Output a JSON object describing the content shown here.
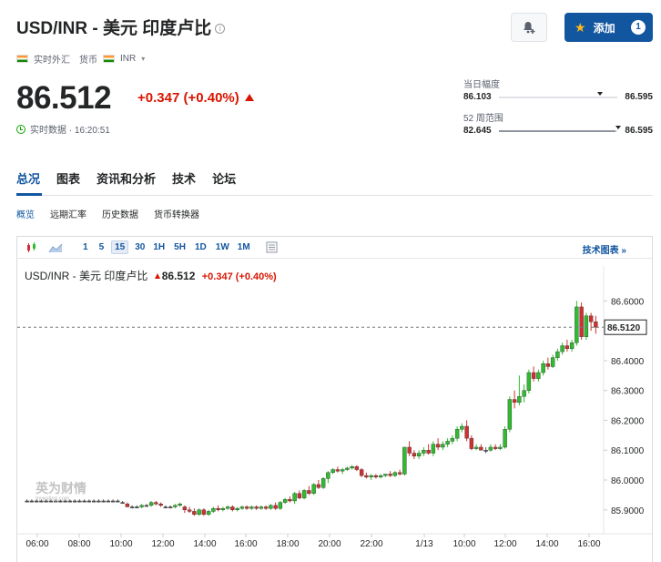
{
  "header": {
    "title": "USD/INR - 美元 印度卢比",
    "info": "i",
    "market_type": "实时外汇",
    "currency_label": "货币",
    "currency": "INR",
    "add_label": "添加",
    "add_count": "1"
  },
  "quote": {
    "price": "86.512",
    "change": "+0.347 (+0.40%)",
    "status": "实时数据 · 16:20:51"
  },
  "day_range": {
    "label": "当日幅度",
    "low": "86.103",
    "high": "86.595",
    "current_fraction": 0.83
  },
  "week52_range": {
    "label": "52 周范围",
    "low": "82.645",
    "high": "86.595",
    "current_fraction": 0.98
  },
  "tabs": [
    "总况",
    "图表",
    "资讯和分析",
    "技术",
    "论坛"
  ],
  "subtabs": [
    "概览",
    "远期汇率",
    "历史数据",
    "货币转换器"
  ],
  "chart_toolbar": {
    "timeframes": [
      "1",
      "5",
      "15",
      "30",
      "1H",
      "5H",
      "1D",
      "1W",
      "1M"
    ],
    "active_timeframe": "15",
    "tech_link": "技术图表 »"
  },
  "chart_header": {
    "symbol": "USD/INR - 美元 印度卢比",
    "price": "86.512",
    "change": "+0.347 (+0.40%)"
  },
  "chart_data": {
    "type": "candlestick",
    "x_ticks": [
      "06:00",
      "08:00",
      "10:00",
      "12:00",
      "14:00",
      "16:00",
      "18:00",
      "20:00",
      "22:00",
      "1/13",
      "10:00",
      "12:00",
      "14:00",
      "16:00"
    ],
    "y_ticks": [
      "86.6000",
      "86.5000",
      "86.4000",
      "86.3000",
      "86.2000",
      "86.1000",
      "86.0000",
      "85.9000"
    ],
    "ylim": [
      85.82,
      86.65
    ],
    "current_price_label": "86.5120",
    "current_price": 86.512,
    "watermark": "英为财情",
    "watermark_sub": "Investing.com",
    "colors": {
      "up": "#2ebd2e",
      "down": "#d32f2f",
      "flat": "#555555"
    },
    "candles": [
      [
        85.93,
        85.935,
        85.925,
        85.93
      ],
      [
        85.93,
        85.935,
        85.925,
        85.93
      ],
      [
        85.93,
        85.935,
        85.925,
        85.93
      ],
      [
        85.93,
        85.935,
        85.925,
        85.93
      ],
      [
        85.93,
        85.935,
        85.925,
        85.93
      ],
      [
        85.93,
        85.935,
        85.925,
        85.93
      ],
      [
        85.93,
        85.935,
        85.925,
        85.93
      ],
      [
        85.93,
        85.935,
        85.925,
        85.93
      ],
      [
        85.93,
        85.935,
        85.925,
        85.93
      ],
      [
        85.93,
        85.935,
        85.925,
        85.93
      ],
      [
        85.93,
        85.935,
        85.925,
        85.93
      ],
      [
        85.93,
        85.935,
        85.925,
        85.93
      ],
      [
        85.93,
        85.935,
        85.925,
        85.93
      ],
      [
        85.93,
        85.935,
        85.925,
        85.93
      ],
      [
        85.93,
        85.935,
        85.925,
        85.93
      ],
      [
        85.93,
        85.935,
        85.925,
        85.93
      ],
      [
        85.93,
        85.935,
        85.925,
        85.93
      ],
      [
        85.93,
        85.935,
        85.925,
        85.93
      ],
      [
        85.93,
        85.935,
        85.925,
        85.93
      ],
      [
        85.93,
        85.935,
        85.925,
        85.93
      ],
      [
        85.925,
        85.93,
        85.92,
        85.925
      ],
      [
        85.92,
        85.925,
        85.915,
        85.91
      ],
      [
        85.91,
        85.915,
        85.905,
        85.91
      ],
      [
        85.91,
        85.915,
        85.905,
        85.91
      ],
      [
        85.91,
        85.92,
        85.905,
        85.915
      ],
      [
        85.915,
        85.92,
        85.91,
        85.915
      ],
      [
        85.915,
        85.93,
        85.91,
        85.925
      ],
      [
        85.925,
        85.93,
        85.915,
        85.92
      ],
      [
        85.92,
        85.925,
        85.91,
        85.915
      ],
      [
        85.91,
        85.915,
        85.905,
        85.91
      ],
      [
        85.91,
        85.915,
        85.905,
        85.91
      ],
      [
        85.91,
        85.92,
        85.905,
        85.915
      ],
      [
        85.915,
        85.925,
        85.91,
        85.92
      ],
      [
        85.91,
        85.915,
        85.89,
        85.9
      ],
      [
        85.9,
        85.91,
        85.89,
        85.895
      ],
      [
        85.895,
        85.905,
        85.88,
        85.885
      ],
      [
        85.885,
        85.905,
        85.88,
        85.9
      ],
      [
        85.9,
        85.905,
        85.88,
        85.885
      ],
      [
        85.885,
        85.9,
        85.88,
        85.895
      ],
      [
        85.895,
        85.91,
        85.89,
        85.905
      ],
      [
        85.905,
        85.915,
        85.895,
        85.9
      ],
      [
        85.9,
        85.91,
        85.895,
        85.905
      ],
      [
        85.905,
        85.915,
        85.9,
        85.91
      ],
      [
        85.91,
        85.915,
        85.895,
        85.9
      ],
      [
        85.9,
        85.91,
        85.895,
        85.905
      ],
      [
        85.905,
        85.915,
        85.9,
        85.91
      ],
      [
        85.91,
        85.915,
        85.9,
        85.905
      ],
      [
        85.905,
        85.915,
        85.9,
        85.91
      ],
      [
        85.91,
        85.915,
        85.9,
        85.905
      ],
      [
        85.905,
        85.915,
        85.9,
        85.91
      ],
      [
        85.91,
        85.915,
        85.9,
        85.905
      ],
      [
        85.905,
        85.92,
        85.9,
        85.915
      ],
      [
        85.915,
        85.925,
        85.9,
        85.905
      ],
      [
        85.905,
        85.93,
        85.9,
        85.925
      ],
      [
        85.925,
        85.94,
        85.92,
        85.935
      ],
      [
        85.935,
        85.945,
        85.925,
        85.93
      ],
      [
        85.93,
        85.96,
        85.92,
        85.955
      ],
      [
        85.955,
        85.965,
        85.935,
        85.94
      ],
      [
        85.94,
        85.97,
        85.935,
        85.965
      ],
      [
        85.965,
        85.98,
        85.95,
        85.955
      ],
      [
        85.955,
        85.99,
        85.95,
        85.985
      ],
      [
        85.985,
        86.0,
        85.97,
        85.975
      ],
      [
        85.975,
        86.01,
        85.97,
        86.005
      ],
      [
        86.005,
        86.03,
        85.99,
        86.025
      ],
      [
        86.025,
        86.04,
        86.02,
        86.035
      ],
      [
        86.035,
        86.045,
        86.025,
        86.03
      ],
      [
        86.03,
        86.04,
        86.02,
        86.035
      ],
      [
        86.035,
        86.045,
        86.03,
        86.04
      ],
      [
        86.04,
        86.05,
        86.035,
        86.045
      ],
      [
        86.045,
        86.05,
        86.03,
        86.035
      ],
      [
        86.035,
        86.04,
        86.01,
        86.015
      ],
      [
        86.015,
        86.025,
        86.005,
        86.01
      ],
      [
        86.01,
        86.02,
        86.0,
        86.015
      ],
      [
        86.015,
        86.02,
        86.005,
        86.01
      ],
      [
        86.01,
        86.02,
        86.005,
        86.015
      ],
      [
        86.015,
        86.02,
        86.01,
        86.02
      ],
      [
        86.02,
        86.03,
        86.01,
        86.015
      ],
      [
        86.015,
        86.03,
        86.01,
        86.025
      ],
      [
        86.025,
        86.035,
        86.015,
        86.02
      ],
      [
        86.02,
        86.11,
        86.015,
        86.11
      ],
      [
        86.11,
        86.13,
        86.08,
        86.09
      ],
      [
        86.09,
        86.1,
        86.07,
        86.08
      ],
      [
        86.08,
        86.1,
        86.07,
        86.09
      ],
      [
        86.09,
        86.11,
        86.08,
        86.1
      ],
      [
        86.1,
        86.12,
        86.085,
        86.09
      ],
      [
        86.09,
        86.13,
        86.08,
        86.12
      ],
      [
        86.12,
        86.14,
        86.1,
        86.11
      ],
      [
        86.11,
        86.13,
        86.1,
        86.12
      ],
      [
        86.12,
        86.14,
        86.11,
        86.13
      ],
      [
        86.13,
        86.15,
        86.12,
        86.14
      ],
      [
        86.14,
        86.18,
        86.13,
        86.17
      ],
      [
        86.17,
        86.19,
        86.16,
        86.18
      ],
      [
        86.18,
        86.2,
        86.13,
        86.14
      ],
      [
        86.14,
        86.15,
        86.1,
        86.105
      ],
      [
        86.105,
        86.12,
        86.1,
        86.11
      ],
      [
        86.11,
        86.12,
        86.1,
        86.1
      ],
      [
        86.1,
        86.11,
        86.09,
        86.1
      ],
      [
        86.1,
        86.12,
        86.095,
        86.11
      ],
      [
        86.11,
        86.12,
        86.1,
        86.105
      ],
      [
        86.105,
        86.12,
        86.1,
        86.11
      ],
      [
        86.11,
        86.18,
        86.105,
        86.17
      ],
      [
        86.17,
        86.28,
        86.16,
        86.27
      ],
      [
        86.27,
        86.3,
        86.24,
        86.26
      ],
      [
        86.26,
        86.35,
        86.25,
        86.28
      ],
      [
        86.28,
        86.32,
        86.26,
        86.3
      ],
      [
        86.3,
        86.37,
        86.29,
        86.36
      ],
      [
        86.36,
        86.38,
        86.33,
        86.34
      ],
      [
        86.34,
        86.37,
        86.33,
        86.36
      ],
      [
        86.36,
        86.4,
        86.35,
        86.39
      ],
      [
        86.39,
        86.41,
        86.37,
        86.38
      ],
      [
        86.38,
        86.42,
        86.375,
        86.41
      ],
      [
        86.41,
        86.44,
        86.4,
        86.43
      ],
      [
        86.43,
        86.46,
        86.42,
        86.45
      ],
      [
        86.45,
        86.47,
        86.43,
        86.44
      ],
      [
        86.44,
        86.47,
        86.43,
        86.46
      ],
      [
        86.46,
        86.6,
        86.45,
        86.58
      ],
      [
        86.58,
        86.595,
        86.47,
        86.48
      ],
      [
        86.48,
        86.56,
        86.47,
        86.55
      ],
      [
        86.55,
        86.56,
        86.5,
        86.53
      ],
      [
        86.53,
        86.55,
        86.49,
        86.512
      ]
    ]
  }
}
